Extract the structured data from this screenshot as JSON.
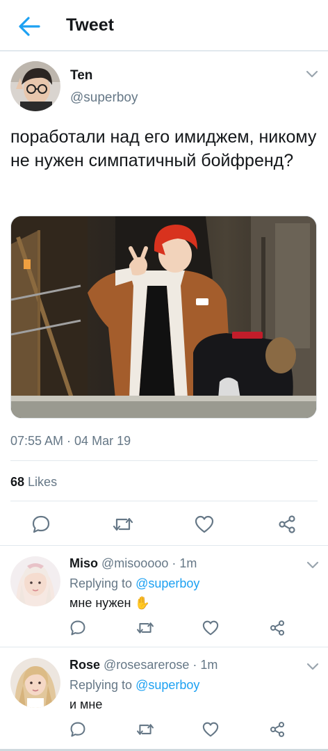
{
  "header": {
    "title": "Tweet"
  },
  "tweet": {
    "author_name": "Ten",
    "author_handle": "@superboy",
    "text": "поработали над его имиджем, никому не нужен симпатичный бойфренд?",
    "timestamp": "07:55 AM · 04 Mar 19",
    "likes_count": "68",
    "likes_label": "Likes"
  },
  "replies": [
    {
      "name": "Miso",
      "handle": "@misooooo",
      "sep": "·",
      "time": "1m",
      "replying_prefix": "Replying to",
      "replying_to": "@superboy",
      "text": "мне нужен",
      "emoji": "✋"
    },
    {
      "name": "Rose",
      "handle": "@rosesarerose",
      "sep": "·",
      "time": "1m",
      "replying_prefix": "Replying to",
      "replying_to": "@superboy",
      "text": "и мне",
      "emoji": ""
    }
  ],
  "icons": {
    "back": "arrow-left-icon",
    "caret": "chevron-down-icon",
    "reply": "comment-icon",
    "retweet": "retweet-icon",
    "like": "heart-icon",
    "share": "share-icon"
  },
  "colors": {
    "accent": "#1da1f2",
    "secondary_text": "#657786",
    "icon_gray": "#657786",
    "divider": "#e1e8ed"
  }
}
